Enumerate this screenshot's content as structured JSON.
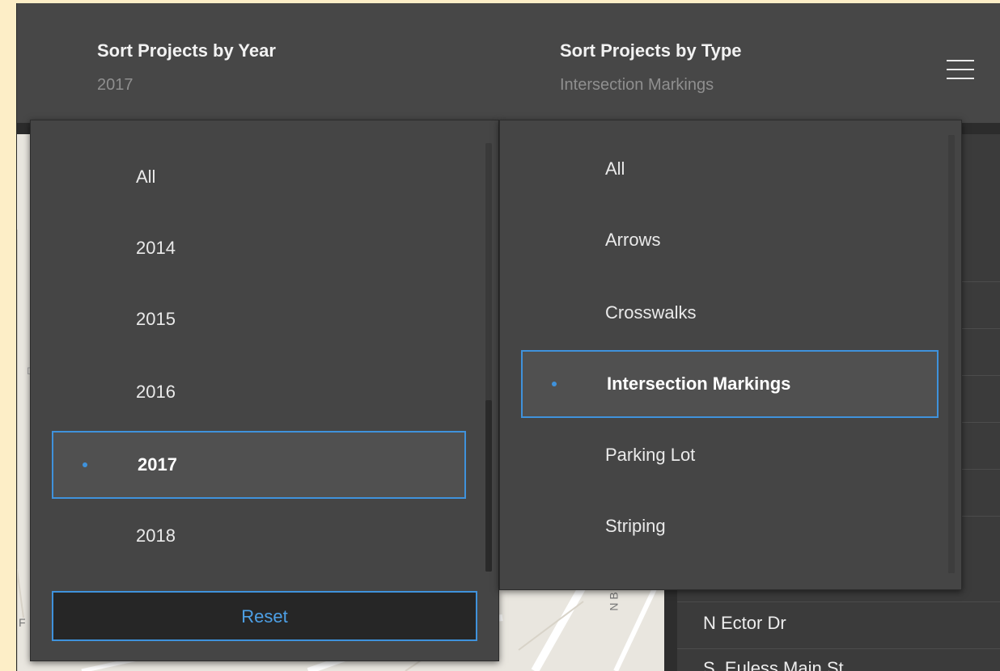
{
  "header": {
    "sort_year": {
      "title": "Sort Projects by Year",
      "value": "2017"
    },
    "sort_type": {
      "title": "Sort Projects by Type",
      "value": "Intersection Markings"
    },
    "menu_icon": "hamburger-menu-icon"
  },
  "year_dropdown": {
    "options": [
      "All",
      "2014",
      "2015",
      "2016",
      "2017",
      "2018"
    ],
    "selected": "2017",
    "reset_label": "Reset"
  },
  "type_dropdown": {
    "options": [
      "All",
      "Arrows",
      "Crosswalks",
      "Intersection Markings",
      "Parking Lot",
      "Striping"
    ],
    "selected": "Intersection Markings"
  },
  "project_list": {
    "items": [
      "N Ector Dr",
      "S. Euless Main St"
    ]
  },
  "map": {
    "labels": [
      "N B",
      "F",
      "D"
    ]
  },
  "colors": {
    "accent": "#3f92dc",
    "panel": "#454545",
    "header": "#474747"
  }
}
